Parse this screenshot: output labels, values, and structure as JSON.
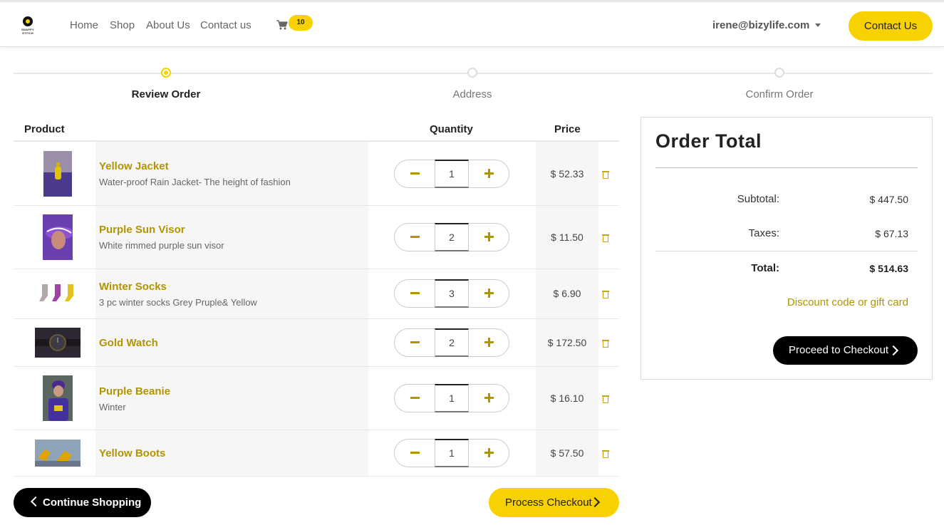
{
  "nav": {
    "logo_text": "SNAPPY STITCH",
    "links": [
      "Home",
      "Shop",
      "About Us",
      "Contact us"
    ],
    "cart_count": "10",
    "user_email": "irene@bizylife.com",
    "contact_button": "Contact Us"
  },
  "steps": [
    {
      "label": "Review Order",
      "active": true
    },
    {
      "label": "Address",
      "active": false
    },
    {
      "label": "Confirm Order",
      "active": false
    }
  ],
  "table": {
    "headers": {
      "product": "Product",
      "quantity": "Quantity",
      "price": "Price"
    },
    "items": [
      {
        "name": "Yellow Jacket",
        "desc": "Water-proof Rain Jacket- The height of fashion",
        "qty": "1",
        "price": "$ 52.33",
        "thumb": "yellow-jacket"
      },
      {
        "name": "Purple Sun Visor",
        "desc": "White rimmed purple sun visor",
        "qty": "2",
        "price": "$ 11.50",
        "thumb": "purple-sun-visor"
      },
      {
        "name": "Winter Socks",
        "desc": "3 pc winter socks Grey Pruple& Yellow",
        "qty": "3",
        "price": "$ 6.90",
        "thumb": "winter-socks"
      },
      {
        "name": "Gold Watch",
        "desc": "",
        "qty": "2",
        "price": "$ 172.50",
        "thumb": "gold-watch"
      },
      {
        "name": "Purple Beanie",
        "desc": "Winter",
        "qty": "1",
        "price": "$ 16.10",
        "thumb": "purple-beanie"
      },
      {
        "name": "Yellow Boots",
        "desc": "",
        "qty": "1",
        "price": "$ 57.50",
        "thumb": "yellow-boots"
      }
    ]
  },
  "actions": {
    "continue": "Continue Shopping",
    "process": "Process Checkout"
  },
  "summary": {
    "title": "Order Total",
    "subtotal_label": "Subtotal:",
    "subtotal": "$ 447.50",
    "taxes_label": "Taxes:",
    "taxes": "$ 67.13",
    "total_label": "Total:",
    "total": "$ 514.63",
    "discount": "Discount code or gift card",
    "checkout": "Proceed to Checkout"
  },
  "colors": {
    "accent": "#f7d100",
    "link": "#b29400",
    "dark": "#000000"
  }
}
